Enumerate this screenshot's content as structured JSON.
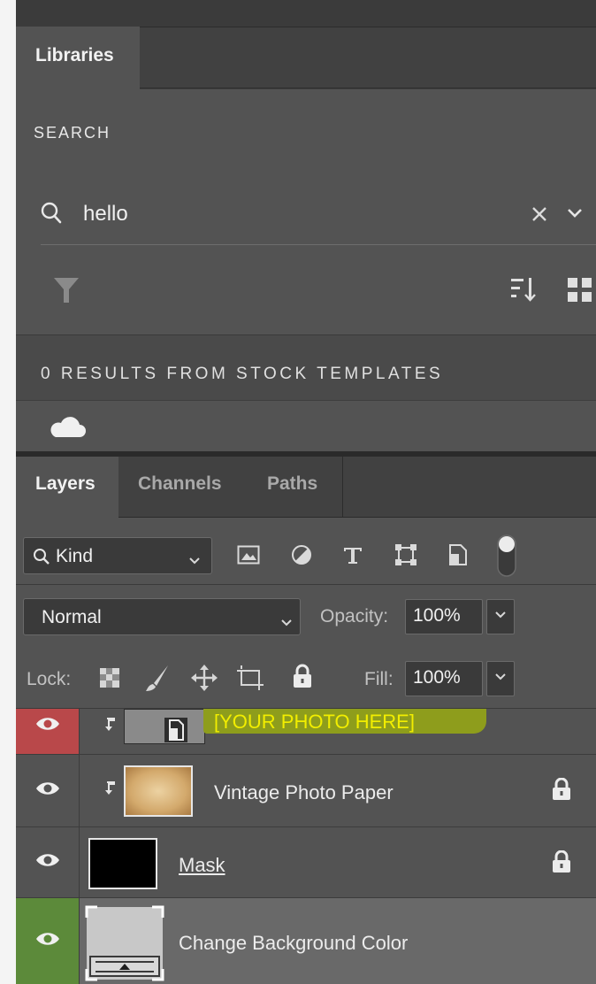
{
  "libraries": {
    "tab": "Libraries",
    "search_label": "SEARCH",
    "search_value": "hello",
    "results_text": "0 RESULTS FROM STOCK TEMPLATES"
  },
  "layers_panel": {
    "tabs": [
      "Layers",
      "Channels",
      "Paths"
    ],
    "filter": {
      "kind_label": "Kind"
    },
    "blend_mode": "Normal",
    "opacity_label": "Opacity:",
    "opacity_value": "100%",
    "lock_label": "Lock:",
    "fill_label": "Fill:",
    "fill_value": "100%",
    "layers": [
      {
        "name": "[YOUR PHOTO HERE]",
        "highlight": "#8e9d1c",
        "text_color": "#f2ee00",
        "eye_bg": "#b9484a"
      },
      {
        "name": "Vintage Photo Paper",
        "locked": true
      },
      {
        "name": "Mask",
        "locked": true
      },
      {
        "name": "Change Background Color",
        "selected": true,
        "eye_bg": "#5c8a3a"
      }
    ]
  },
  "colors": {
    "panel_bg": "#535353",
    "tabbar_bg": "#414141",
    "selected_row": "#696969",
    "red_eye": "#b9484a",
    "green_eye": "#5c8a3a",
    "highlight": "#8e9d1c",
    "highlight_text": "#f2ee00"
  }
}
